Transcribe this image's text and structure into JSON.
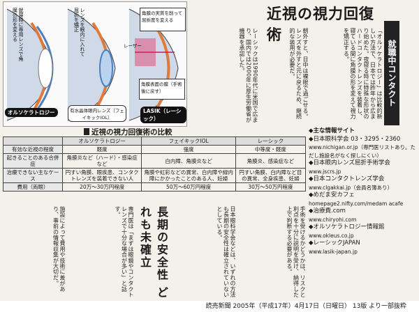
{
  "headline": "近視の視力回復術",
  "series_tag": "就職中コンタクト",
  "diagram": {
    "labels": {
      "ortho_top": "就寝時に専用レンズで角膜の形を変える",
      "phakic_top": "レンズを眼内に入れて屈折を矯正",
      "lasik_top": "角膜の実質を削って屈折度を変える",
      "laser": "レーザー",
      "flap": "角膜表面の膜（手術後に戻す）"
    },
    "captions": {
      "ortho": "オルソケラトロジー",
      "phakic": "有水晶体眼内レンズ（フェイキックIOL）",
      "lasik": "LASIK（レーシック）"
    }
  },
  "table": {
    "title": "近視の視力回復術の比較",
    "columns": [
      "",
      "オルソケラトロジー",
      "フェイキックIOL",
      "レーシック"
    ],
    "rows": [
      {
        "label": "有効な近視の程度",
        "cells": [
          "軽度",
          "強度",
          "中等度・軽度"
        ]
      },
      {
        "label": "起きることのある合併症",
        "cells": [
          "角膜炎など（ハード）・感染症など",
          "白内障、角膜炎など",
          "角膜炎、感染症など"
        ]
      },
      {
        "label": "治療できない主なケース",
        "cells": [
          "円すい角膜、眼疾患、コンタクトレンズを装着できない人",
          "角膜や虹彩などの異常、白内障や緑内障にかかったことのある人、妊婦",
          "円すい角膜、白内障など目の異常、全身疾患、妊婦"
        ]
      },
      {
        "label": "費用（両眼）",
        "cells": [
          "20万〜30万円程度",
          "50万〜60万円程度",
          "30万〜50万円程度"
        ]
      }
    ]
  },
  "lower_headline": "長期の安全性 どれも未確立",
  "info_sites": {
    "title": "◆主な情報サイト",
    "items": [
      "◆日本眼科学会 03・3295・2360",
      "www.nichigan.or.jp（専門医リストあり。ただし施設名がなく探しにくい）",
      "◆日本眼内レンズ屈折手術学会",
      "www.jscrs.jp",
      "◆日本コンタクトレンズ学会",
      "www.clgakkai.jp（会員名簿あり）",
      "◆めだま安カフェ",
      "homepage2.nifty.com/medam acafe",
      "◆治療費.com",
      "www.chiryohi.com",
      "◆オルソケラトロジー情報館",
      "www.okleus.co.jp",
      "◆レーシックJAPAN",
      "www.lasik-japan.jp"
    ]
  },
  "body_columns": [
    "「オルソケラトロジー」は比較的新しい方法で、日本では昨年から広まり始めた。夜寝る時に特殊な形状のハードコンタクトレンズを装着し、寝ている間に角膜の形を変えて視力を矯正する。",
    "朝外すと、日中は裸眼で過ごせる。レンズを外すと元に戻るため、継続的な装用が必要だ。",
    "米国では2002年に承認されたが、国内では未承認。角膜の形を変えるため、長期的な影響は不明だ。",
    "眼の中に人工のレンズを入れる「フェイキックIOL」は、強度の近視でも矯正できる。",
    "レーシックは角膜の表面を薄く切ってめくり、レーザーで削って屈折度を変える方法。",
    "日本眼科学会などは、いずれの方法も長期の安全性は確立されていないとしている。",
    "手術を受けるかどうかは、リスクと利点を十分に説明を受け、納得した上で判断する必要がある。",
    "専門医は「まずは眼鏡やコンタクトレンズで十分な場合が多い」と話す。",
    "施設によって費用や技術に差があり、事前の情報収集が大切だ。",
    "国内でも手術件数は増えているが、合併症の報告もある。",
    "レーシックは1990年代に米国で広まり、国内では2000年に厚生労働省が機器を承認した。"
  ],
  "footer": "読売新聞 2005年（平成17年）4月17日（日曜日） 13版 より一部抜粋"
}
